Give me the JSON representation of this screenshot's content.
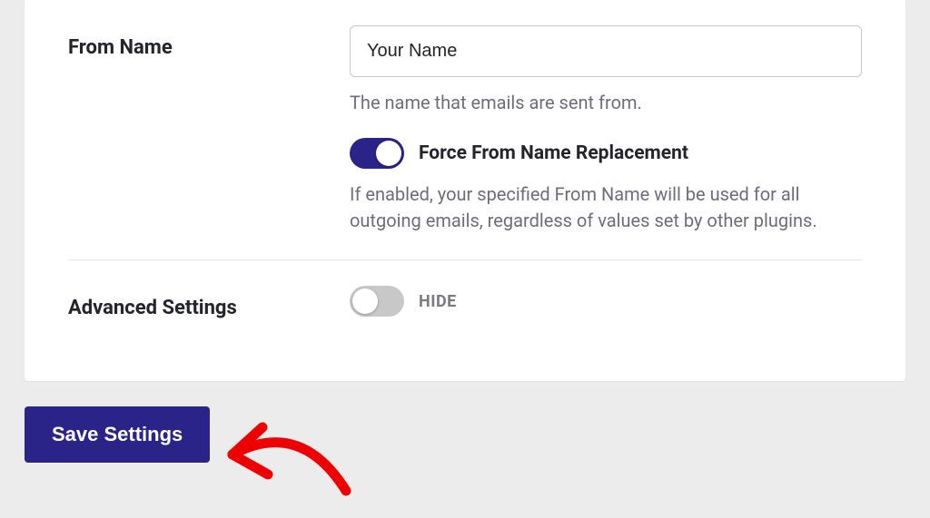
{
  "from_name": {
    "label": "From Name",
    "value": "Your Name",
    "helper": "The name that emails are sent from.",
    "force": {
      "label": "Force From Name Replacement",
      "helper": "If enabled, your specified From Name will be used for all outgoing emails, regardless of values set by other plugins."
    }
  },
  "advanced": {
    "label": "Advanced Settings",
    "state_label": "HIDE"
  },
  "save_label": "Save Settings",
  "colors": {
    "accent": "#2b2488"
  }
}
